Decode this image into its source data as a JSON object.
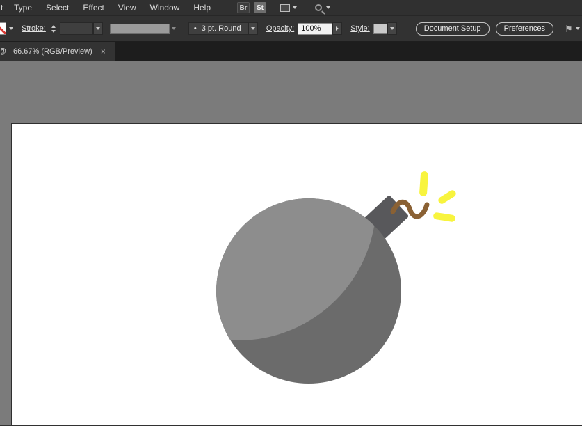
{
  "menubar": {
    "partial_item": "t",
    "items": [
      "Type",
      "Select",
      "Effect",
      "View",
      "Window",
      "Help"
    ],
    "bridge_badge": "Br",
    "stock_badge": "St"
  },
  "controlbar": {
    "stroke_label": "Stroke:",
    "brush_bullet": "•",
    "brush_value": "3 pt. Round",
    "opacity_label": "Opacity:",
    "opacity_value": "100%",
    "style_label": "Style:",
    "document_setup_label": "Document Setup",
    "preferences_label": "Preferences"
  },
  "tabbar": {
    "at_prefix": "@",
    "active_tab_label": "66.67% (RGB/Preview)",
    "close_glyph": "×"
  },
  "canvas": {
    "pasteboard_color": "#7b7b7b",
    "artboard_color": "#ffffff"
  },
  "bomb": {
    "body_color": "#6b6b6b",
    "highlight_color": "#8d8d8d",
    "cap_color": "#58585b",
    "fuse_color": "#8a6134",
    "spark_color": "#f8f43e"
  }
}
